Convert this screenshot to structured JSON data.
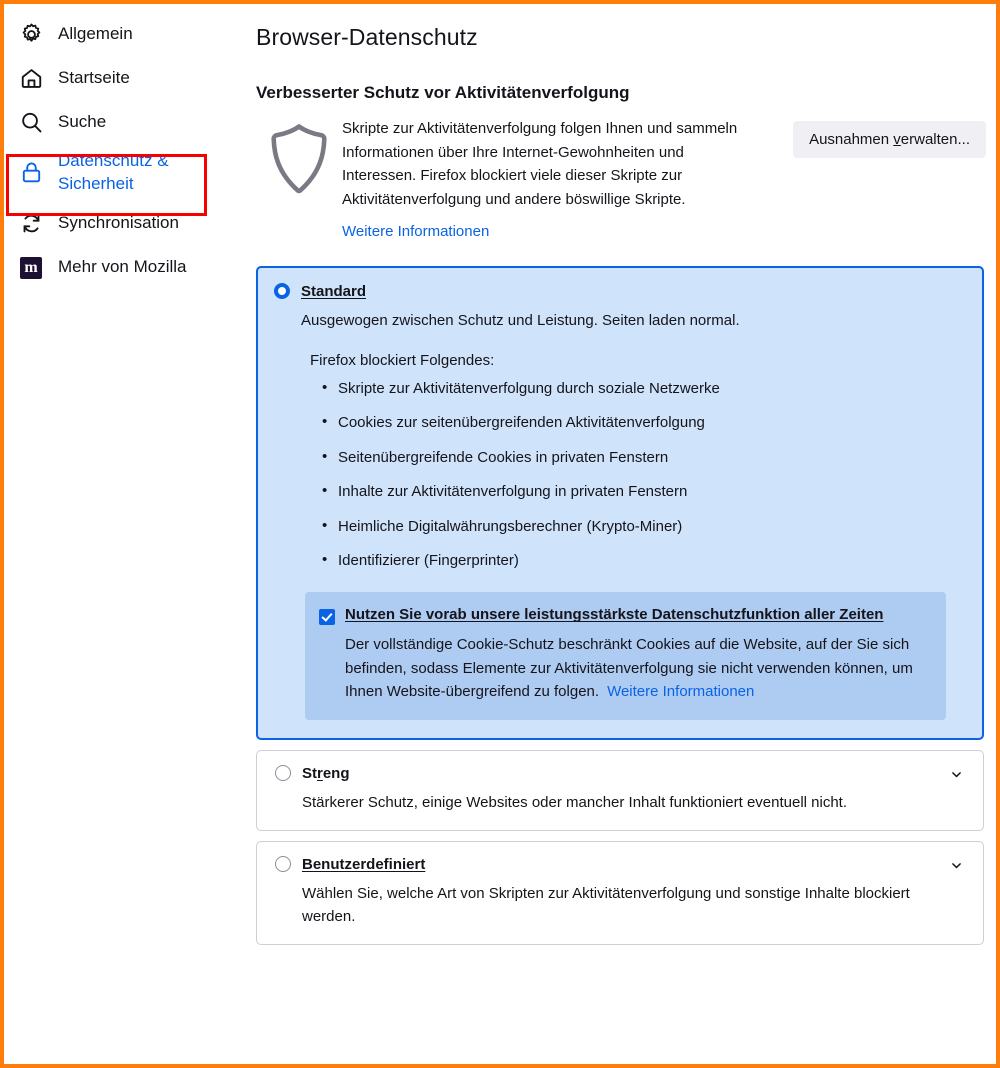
{
  "window": {
    "frame_color": "#ff7d0a",
    "accent_color": "#0a63e4",
    "highlight_color": "#f60000"
  },
  "sidebar": {
    "items": [
      {
        "label": "Allgemein",
        "icon": "gear-icon",
        "active": false
      },
      {
        "label": "Startseite",
        "icon": "home-icon",
        "active": false
      },
      {
        "label": "Suche",
        "icon": "search-icon",
        "active": false
      },
      {
        "label": "Datenschutz &\nSicherheit",
        "icon": "lock-icon",
        "active": true
      },
      {
        "label": "Synchronisation",
        "icon": "sync-icon",
        "active": false
      },
      {
        "label": "Mehr von Mozilla",
        "icon": "mozilla-m-icon",
        "active": false
      }
    ]
  },
  "main": {
    "page_title": "Browser-Datenschutz",
    "section_title": "Verbesserter Schutz vor Aktivitätenverfolgung",
    "etp_description": "Skripte zur Aktivitätenverfolgung folgen Ihnen und sammeln Informationen über Ihre Internet-Gewohnheiten und Interessen. Firefox blockiert viele dieser Skripte zur Aktivitätenverfolgung und andere böswillige Skripte.",
    "etp_learn_more": "Weitere Informationen",
    "exceptions_button": "Ausnahmen verwalten...",
    "options": {
      "standard": {
        "label": "Standard",
        "selected": true,
        "description": "Ausgewogen zwischen Schutz und Leistung. Seiten laden normal.",
        "blocks_intro": "Firefox blockiert Folgendes:",
        "blocked_items": [
          "Skripte zur Aktivitätenverfolgung durch soziale Netzwerke",
          "Cookies zur seitenübergreifenden Aktivitätenverfolgung",
          "Seitenübergreifende Cookies in privaten Fenstern",
          "Inhalte zur Aktivitätenverfolgung in privaten Fenstern",
          "Heimliche Digitalwährungsberechner (Krypto-Miner)",
          "Identifizierer (Fingerprinter)"
        ],
        "cookie_banner": {
          "checked": true,
          "title": "Nutzen Sie vorab unsere leistungsstärkste Datenschutzfunktion aller Zeiten",
          "description": "Der vollständige Cookie-Schutz beschränkt Cookies auf die Website, auf der Sie sich befinden, sodass Elemente zur Aktivitätenverfolgung sie nicht verwenden können, um Ihnen Website-übergreifend zu folgen.",
          "learn_more": "Weitere Informationen"
        }
      },
      "strict": {
        "label": "Streng",
        "selected": false,
        "description": "Stärkerer Schutz, einige Websites oder mancher Inhalt funktioniert eventuell nicht."
      },
      "custom": {
        "label": "Benutzerdefiniert",
        "selected": false,
        "description": "Wählen Sie, welche Art von Skripten zur Aktivitätenverfolgung und sonstige Inhalte blockiert werden."
      }
    }
  }
}
